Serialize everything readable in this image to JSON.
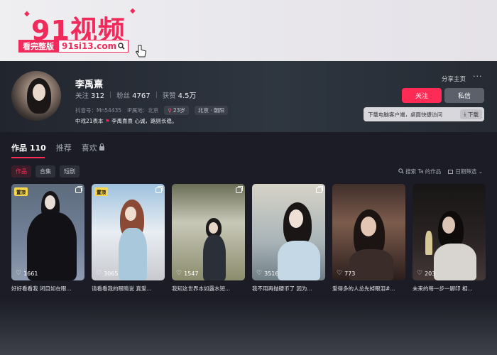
{
  "banner": {
    "logo_title": "91视频",
    "sub_red": "看完整版",
    "sub_white": "91si13.com"
  },
  "profile": {
    "name": "李禹熹",
    "stats": [
      {
        "label": "关注",
        "value": "312"
      },
      {
        "label": "粉丝",
        "value": "4767"
      },
      {
        "label": "获赞",
        "value": "4.5万"
      }
    ],
    "douyin_id": "抖音号：Mn54435",
    "ip_location": "IP属地：北京",
    "age_chip": "23岁",
    "region_chip": "北京 · 朝阳",
    "bio_prefix": "中戏21表本",
    "bio_text": "李禹熹熹 心诚，路则长稳。"
  },
  "actions": {
    "share": "分享主页",
    "more": "···",
    "follow": "关注",
    "message": "私信",
    "download_text": "下载电脑客户端，桌面快捷访问",
    "download_btn": "下载"
  },
  "tabs": [
    {
      "label": "作品 110"
    },
    {
      "label": "推荐"
    },
    {
      "label": "喜欢"
    }
  ],
  "filters": [
    "作品",
    "合集",
    "短剧"
  ],
  "tools": {
    "search": "搜索 Ta 的作品",
    "date_filter": "日期筛选"
  },
  "videos": [
    {
      "pinned": "置顶",
      "likes": "1661",
      "caption": "好好看看我 闭目如在眼..."
    },
    {
      "pinned": "置顶",
      "likes": "3065",
      "caption": "请看看我的眼睛说 真爱..."
    },
    {
      "pinned": "",
      "likes": "1547",
      "caption": "我知这世界本如露水短..."
    },
    {
      "pinned": "",
      "likes": "3516",
      "caption": "我不用再抛硬币了 因为..."
    },
    {
      "pinned": "",
      "likes": "773",
      "caption": "爱得多的人总先掉眼泪#..."
    },
    {
      "pinned": "",
      "likes": "203",
      "caption": "未来的每一步一脚印 相..."
    }
  ],
  "colors": {
    "accent": "#fe2c55",
    "background": "#1b1c25",
    "pin": "#f7d54c"
  }
}
